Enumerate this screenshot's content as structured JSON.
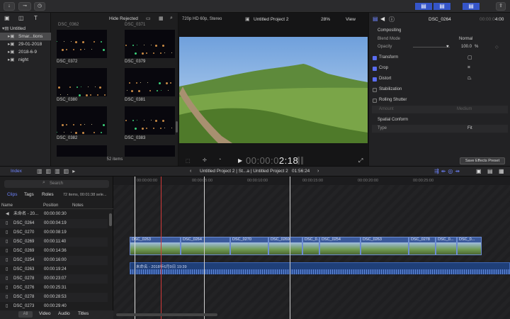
{
  "toolbar": {
    "left_icons": [
      "import-icon",
      "keywords-icon",
      "background-tasks-icon"
    ],
    "view_toggles": [
      "library-toggle",
      "timeline-toggle",
      "inspector-toggle"
    ],
    "share_icon": "share-icon"
  },
  "library": {
    "items": [
      {
        "label": "Untitled",
        "level": 0,
        "icon": "library-icon"
      },
      {
        "label": "Smar...tions",
        "level": 1,
        "icon": "smart-collection-icon",
        "selected": true
      },
      {
        "label": "29-01-2018",
        "level": 1,
        "icon": "event-icon"
      },
      {
        "label": "2018-6-9",
        "level": 1,
        "icon": "event-icon"
      },
      {
        "label": "night",
        "level": 1,
        "icon": "event-icon"
      }
    ]
  },
  "browser": {
    "filter": "Hide Rejected",
    "top_labels": [
      "DSC_0362",
      "DSC_0371"
    ],
    "clips": [
      {
        "label": "DSC_0372"
      },
      {
        "label": "DSC_0379"
      },
      {
        "label": "DSC_0380"
      },
      {
        "label": "DSC_0381"
      },
      {
        "label": "DSC_0382"
      },
      {
        "label": "DSC_0383"
      }
    ],
    "count": "52 items"
  },
  "viewer": {
    "format": "720p HD 60p, Stereo",
    "project": "Untitled Project 2",
    "zoom": "28%",
    "view_label": "View",
    "timecode": "00:00:02:18",
    "timecode_dim": "00:00:0",
    "timecode_bright": "2:18"
  },
  "inspector": {
    "clip_name": "DSC_0264",
    "duration": "00:00:04:00",
    "duration_dim": "00:00:0",
    "duration_bright": "4:00",
    "compositing": "Compositing",
    "blend_mode_label": "Blend Mode",
    "blend_mode_value": "Normal",
    "opacity_label": "Opacity",
    "opacity_value": "100.0",
    "opacity_unit": "%",
    "transform": "Transform",
    "crop": "Crop",
    "distort": "Distort",
    "stabilization": "Stabilization",
    "rolling_shutter": "Rolling Shutter",
    "amount_label": "Amount",
    "amount_value": "Medium",
    "spatial_conform": "Spatial Conform",
    "type_label": "Type",
    "type_value": "Fit",
    "save_preset": "Save Effects Preset"
  },
  "timeline_bar": {
    "index_label": "Index",
    "project_path": "Untitled Project 2 | St...a | Untitled Project 2",
    "duration": "01:56:24"
  },
  "index": {
    "search_placeholder": "Search",
    "tabs": [
      "Clips",
      "Tags",
      "Roles"
    ],
    "summary": "72 items, 00:01:38 sele...",
    "columns": [
      "Name",
      "Position",
      "Notes"
    ],
    "rows": [
      {
        "name": "未命名 - 20...",
        "position": "00:00:00:30"
      },
      {
        "name": "DSC_0264",
        "position": "00:00:04:19"
      },
      {
        "name": "DSC_0270",
        "position": "00:00:08:19"
      },
      {
        "name": "DSC_0269",
        "position": "00:00:11:40"
      },
      {
        "name": "DSC_0269",
        "position": "00:00:14:36"
      },
      {
        "name": "DSC_0254",
        "position": "00:00:16:00"
      },
      {
        "name": "DSC_0263",
        "position": "00:00:19:24"
      },
      {
        "name": "DSC_0278",
        "position": "00:00:23:07"
      },
      {
        "name": "DSC_0276",
        "position": "00:00:25:31"
      },
      {
        "name": "DSC_0278",
        "position": "00:00:28:53"
      },
      {
        "name": "DSC_0273",
        "position": "00:00:29:40"
      }
    ],
    "bottom_tabs": [
      "All",
      "Video",
      "Audio",
      "Titles"
    ]
  },
  "timeline": {
    "ruler": [
      "00:00:00:00",
      "00:00:05:00",
      "00:00:10:00",
      "00:00:15:00",
      "00:00:20:00",
      "00:00:25:00"
    ],
    "video_clips": [
      "DSC_0263",
      "DSC_0264",
      "DSC_0270",
      "DSC_0269",
      "DSC_0...",
      "DSC_0254",
      "DSC_0263",
      "DSC_0278",
      "DSC_0...",
      "DSC_0..."
    ],
    "audio_clip": "未命名 - 2018年6月9日 19:39"
  },
  "colors": {
    "accent": "#5a6df0",
    "clip_fill": "#3b5a9c",
    "audio_fill": "#1f3f78",
    "playhead": "#e0e0e0",
    "skimmer": "#d23a3a"
  }
}
